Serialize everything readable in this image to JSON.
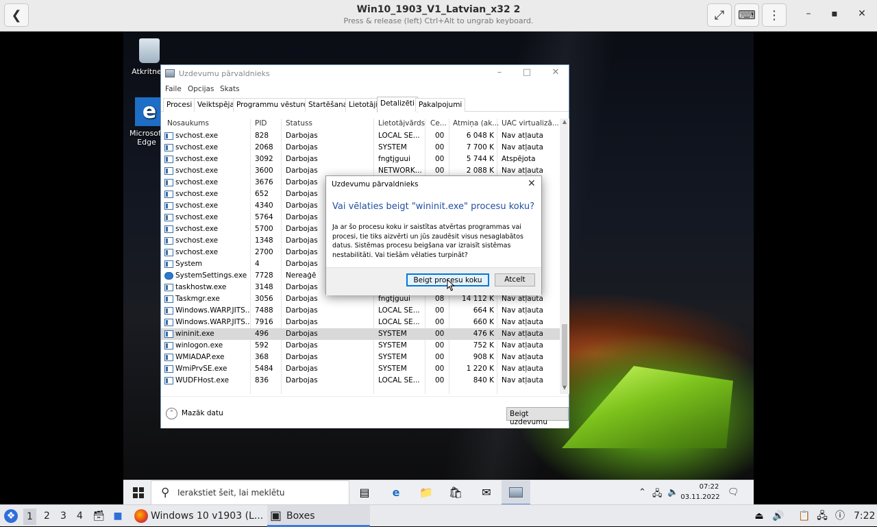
{
  "host": {
    "title": "Win10_1903_V1_Latvian_x32 2",
    "subtitle": "Press & release (left) Ctrl+Alt to ungrab keyboard.",
    "back_icon": "chevron-left-icon",
    "fullscreen_icon": "expand-icon",
    "keyboard_icon": "keyboard-icon",
    "menu_icon": "kebab-menu-icon",
    "min_glyph": "–",
    "max_glyph": "▪",
    "close_glyph": "✕"
  },
  "desktop": {
    "recycle_label": "Atkritne",
    "edge_label_1": "Microsoft",
    "edge_label_2": "Edge"
  },
  "taskmgr": {
    "title": "Uzdevumu pārvaldnieks",
    "menu": [
      "Faile",
      "Opcijas",
      "Skats"
    ],
    "tabs": [
      "Procesi",
      "Veiktspēja",
      "Programmu vēsture",
      "Startēšana",
      "Lietotāji",
      "Detalizēti",
      "Pakalpojumi"
    ],
    "active_tab": "Detalizēti",
    "columns": [
      "Nosaukums",
      "PID",
      "Statuss",
      "Lietotājvārds",
      "Ce...",
      "Atmiņa (ak...",
      "UAC virtualizā..."
    ],
    "rows": [
      {
        "name": "svchost.exe",
        "pid": "828",
        "status": "Darbojas",
        "user": "LOCAL SE...",
        "cpu": "00",
        "mem": "6 048 K",
        "uac": "Nav atļauta"
      },
      {
        "name": "svchost.exe",
        "pid": "2068",
        "status": "Darbojas",
        "user": "SYSTEM",
        "cpu": "00",
        "mem": "7 700 K",
        "uac": "Nav atļauta"
      },
      {
        "name": "svchost.exe",
        "pid": "3092",
        "status": "Darbojas",
        "user": "fngtjguui",
        "cpu": "00",
        "mem": "5 744 K",
        "uac": "Atspējota"
      },
      {
        "name": "svchost.exe",
        "pid": "3600",
        "status": "Darbojas",
        "user": "NETWORK...",
        "cpu": "00",
        "mem": "2 088 K",
        "uac": "Nav atļauta"
      },
      {
        "name": "svchost.exe",
        "pid": "3676",
        "status": "Darbojas",
        "user": "",
        "cpu": "",
        "mem": "",
        "uac": ""
      },
      {
        "name": "svchost.exe",
        "pid": "652",
        "status": "Darbojas",
        "user": "",
        "cpu": "",
        "mem": "",
        "uac": ""
      },
      {
        "name": "svchost.exe",
        "pid": "4340",
        "status": "Darbojas",
        "user": "",
        "cpu": "",
        "mem": "",
        "uac": ""
      },
      {
        "name": "svchost.exe",
        "pid": "5764",
        "status": "Darbojas",
        "user": "",
        "cpu": "",
        "mem": "",
        "uac": ""
      },
      {
        "name": "svchost.exe",
        "pid": "5700",
        "status": "Darbojas",
        "user": "",
        "cpu": "",
        "mem": "",
        "uac": ""
      },
      {
        "name": "svchost.exe",
        "pid": "1348",
        "status": "Darbojas",
        "user": "",
        "cpu": "",
        "mem": "",
        "uac": ""
      },
      {
        "name": "svchost.exe",
        "pid": "2700",
        "status": "Darbojas",
        "user": "",
        "cpu": "",
        "mem": "",
        "uac": ""
      },
      {
        "name": "System",
        "pid": "4",
        "status": "Darbojas",
        "user": "",
        "cpu": "",
        "mem": "",
        "uac": ""
      },
      {
        "name": "SystemSettings.exe",
        "pid": "7728",
        "status": "Nereaģē",
        "user": "",
        "cpu": "",
        "mem": "",
        "uac": ""
      },
      {
        "name": "taskhostw.exe",
        "pid": "3148",
        "status": "Darbojas",
        "user": "",
        "cpu": "",
        "mem": "",
        "uac": ""
      },
      {
        "name": "Taskmgr.exe",
        "pid": "3056",
        "status": "Darbojas",
        "user": "fngtjguui",
        "cpu": "08",
        "mem": "14 112 K",
        "uac": "Nav atļauta"
      },
      {
        "name": "Windows.WARP.JITS...",
        "pid": "7488",
        "status": "Darbojas",
        "user": "LOCAL SE...",
        "cpu": "00",
        "mem": "664 K",
        "uac": "Nav atļauta"
      },
      {
        "name": "Windows.WARP.JITS...",
        "pid": "7916",
        "status": "Darbojas",
        "user": "LOCAL SE...",
        "cpu": "00",
        "mem": "660 K",
        "uac": "Nav atļauta"
      },
      {
        "name": "wininit.exe",
        "pid": "496",
        "status": "Darbojas",
        "user": "SYSTEM",
        "cpu": "00",
        "mem": "476 K",
        "uac": "Nav atļauta"
      },
      {
        "name": "winlogon.exe",
        "pid": "592",
        "status": "Darbojas",
        "user": "SYSTEM",
        "cpu": "00",
        "mem": "752 K",
        "uac": "Nav atļauta"
      },
      {
        "name": "WMIADAP.exe",
        "pid": "368",
        "status": "Darbojas",
        "user": "SYSTEM",
        "cpu": "00",
        "mem": "908 K",
        "uac": "Nav atļauta"
      },
      {
        "name": "WmiPrvSE.exe",
        "pid": "5484",
        "status": "Darbojas",
        "user": "SYSTEM",
        "cpu": "00",
        "mem": "1 220 K",
        "uac": "Nav atļauta"
      },
      {
        "name": "WUDFHost.exe",
        "pid": "836",
        "status": "Darbojas",
        "user": "LOCAL SE...",
        "cpu": "00",
        "mem": "840 K",
        "uac": "Nav atļauta"
      }
    ],
    "selected_row": "wininit.exe",
    "less_details": "Mazāk datu",
    "end_task": "Beigt uzdevumu"
  },
  "dialog": {
    "caption": "Uzdevumu pārvaldnieks",
    "main": "Vai vēlaties beigt \"wininit.exe\" procesu koku?",
    "body": "Ja ar šo procesu koku ir saistītas atvērtas programmas vai procesi, tie tiks aizvērti un jūs zaudēsit visus nesaglabātos datus. Sistēmas procesu beigšana var izraisīt sistēmas nestabilitāti. Vai tiešām vēlaties turpināt?",
    "confirm": "Beigt procesu koku",
    "cancel": "Atcelt"
  },
  "win_taskbar": {
    "search_placeholder": "Ierakstiet šeit, lai meklētu",
    "time": "07:22",
    "date": "03.11.2022"
  },
  "host_panel": {
    "workspaces": [
      "1",
      "2",
      "3",
      "4"
    ],
    "tasks": [
      "Windows 10 v1903 (L...",
      "Boxes"
    ],
    "clock": "7:22"
  }
}
